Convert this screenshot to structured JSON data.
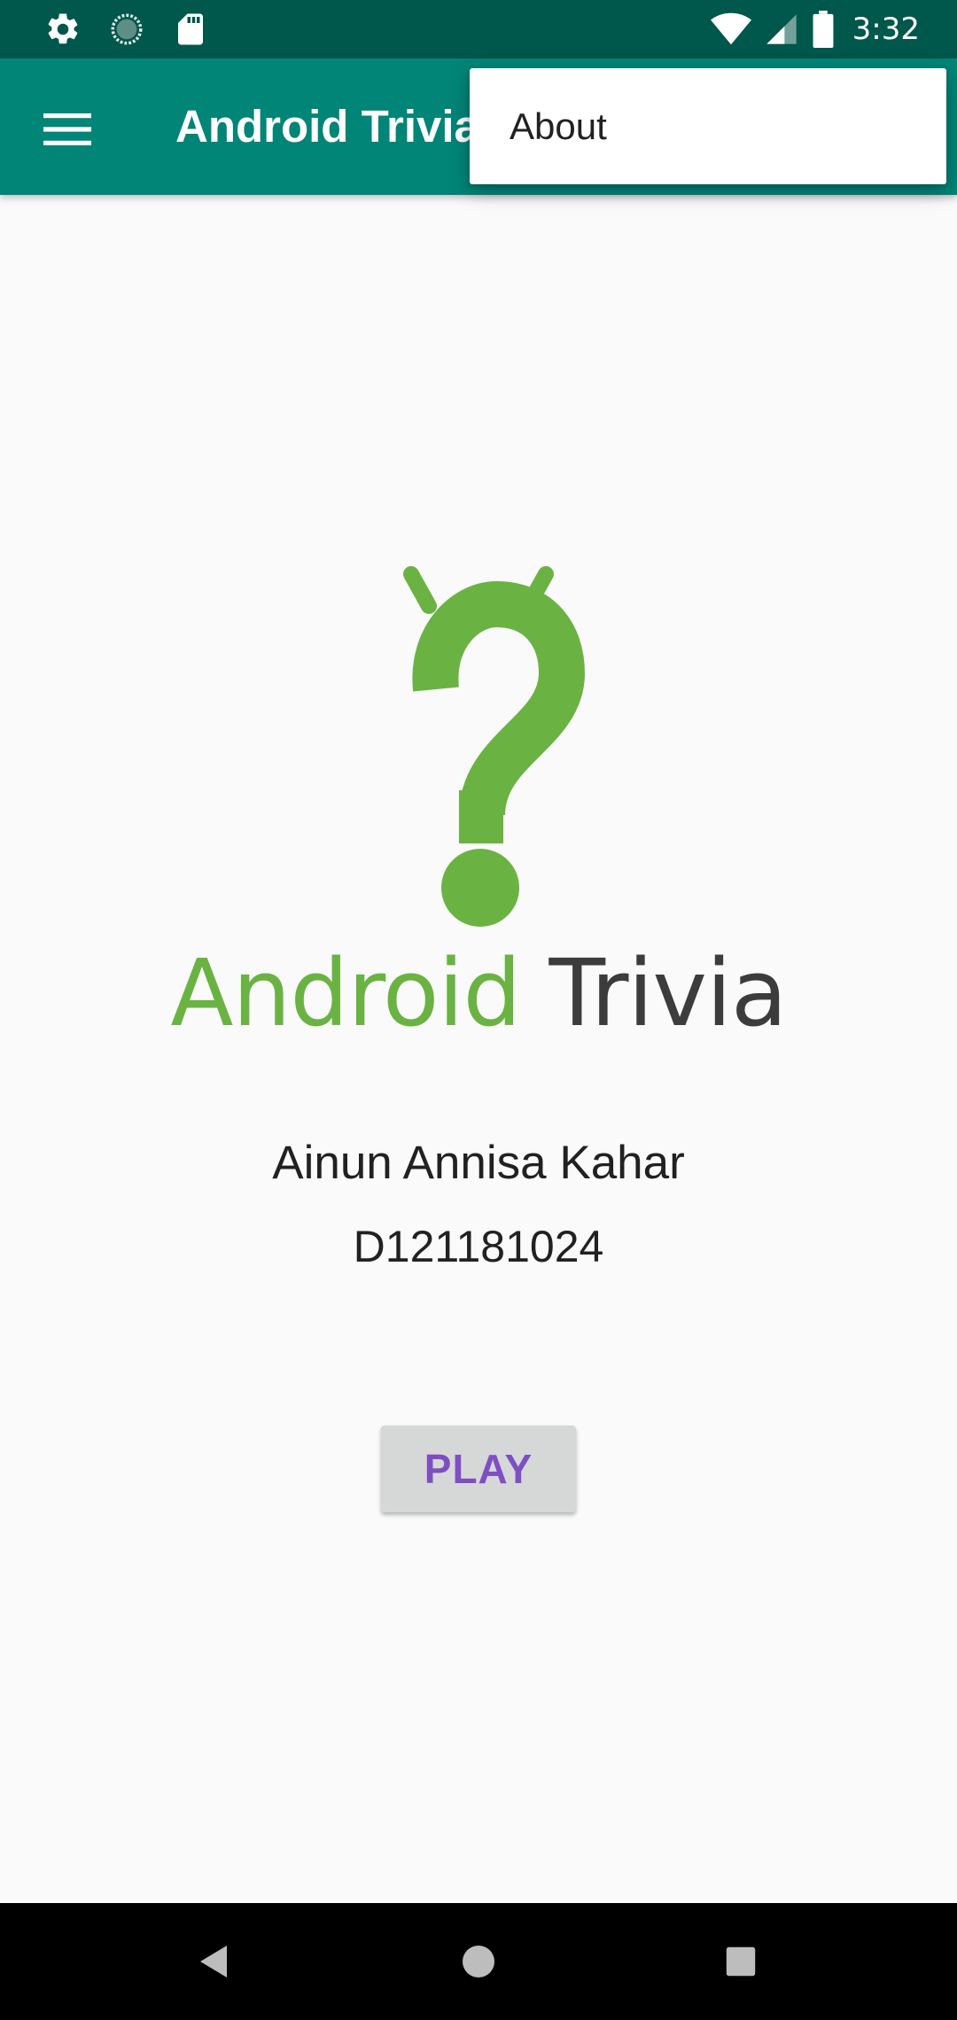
{
  "status_bar": {
    "time": "3:32",
    "left_icons": [
      "settings-icon",
      "sync-circle-icon",
      "sd-card-icon"
    ],
    "right_icons": [
      "wifi-icon",
      "signal-icon",
      "battery-icon"
    ]
  },
  "toolbar": {
    "title": "Android Trivia",
    "menu_icon": "hamburger-menu-icon",
    "background": "#008577"
  },
  "overflow_menu": {
    "items": [
      {
        "label": "About"
      }
    ]
  },
  "logo": {
    "word1": "Android",
    "word2": "Trivia",
    "green": "#6AB343",
    "dark": "#3C3C3C"
  },
  "main": {
    "name": "Ainun Annisa Kahar",
    "id": "D121181024",
    "play_label": "PLAY"
  },
  "nav_bar": {
    "icons": [
      "back-icon",
      "home-icon",
      "recents-icon"
    ]
  },
  "colors": {
    "status_bar": "#00574B",
    "accent": "#7E4FC2",
    "background": "#FAFAFA"
  }
}
